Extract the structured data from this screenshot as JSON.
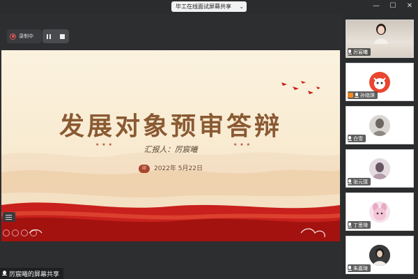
{
  "window": {
    "title": "毕工在线面试屏幕共享",
    "title_chevron": "⌄",
    "controls": [
      "—",
      "☐",
      "✕"
    ]
  },
  "recording": {
    "status_label": "录制中"
  },
  "slide": {
    "title": "发展对象预审答辩",
    "reporter": "汇报人：厉宸曦",
    "date": "2022年 5月22日",
    "seal_text": "印",
    "deco": "★ ★ ★"
  },
  "share": {
    "label": "厉宸曦的屏幕共享"
  },
  "participants": [
    {
      "name": "厉宸曦",
      "kind": "video",
      "icon": "mic-icon"
    },
    {
      "name": "孙晓琪",
      "kind": "avatar",
      "icon": "screen-share-icon",
      "avatar_color": "#e9462f"
    },
    {
      "name": "白雪",
      "kind": "avatar",
      "icon": "mic-icon",
      "avatar_color": "#9b9b9b"
    },
    {
      "name": "张元璞",
      "kind": "avatar",
      "icon": "mic-icon",
      "avatar_color": "#b39ba8"
    },
    {
      "name": "丁思琦",
      "kind": "avatar",
      "icon": "mic-icon",
      "avatar_color": "#e7a9c4"
    },
    {
      "name": "朱嘉琦",
      "kind": "avatar",
      "icon": "mic-icon",
      "avatar_color": "#3c3c3c"
    }
  ],
  "colors": {
    "accent_red": "#c8201c",
    "title_brown": "#8a5a33",
    "background": "#2b2c2e"
  }
}
